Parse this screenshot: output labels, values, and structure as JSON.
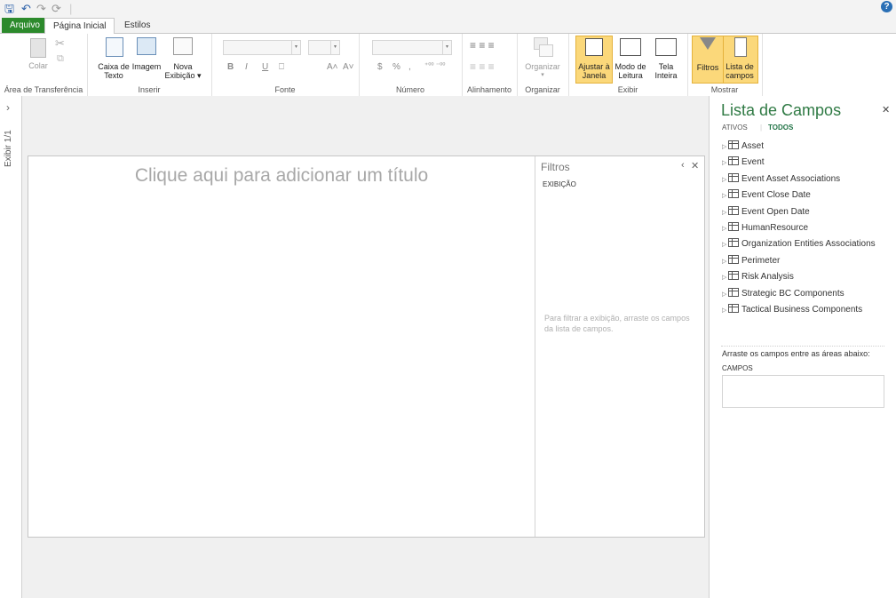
{
  "quick_access": {
    "save_icon": "save-icon",
    "undo_icon": "undo-icon",
    "redo_icon": "redo-icon",
    "refresh_icon": "refresh-icon"
  },
  "tabs": {
    "file": "Arquivo",
    "home": "Página Inicial",
    "styles": "Estilos"
  },
  "ribbon": {
    "clipboard": {
      "paste": "Colar",
      "group": "Área de Transferência"
    },
    "insert": {
      "textbox_1": "Caixa de",
      "textbox_2": "Texto",
      "image": "Imagem",
      "newview_1": "Nova",
      "newview_2": "Exibição ▾",
      "group": "Inserir"
    },
    "font": {
      "bold": "B",
      "italic": "I",
      "underline": "U",
      "grow": "A˄",
      "shrink": "A˅",
      "group": "Fonte"
    },
    "number": {
      "currency": "$",
      "percent": "%",
      "thousands": ",",
      "inc_dec": "⁺⁰⁰ ⁻⁰⁰",
      "group": "Número"
    },
    "alignment": {
      "group": "Alinhamento"
    },
    "arrange": {
      "arrange": "Organizar",
      "group": "Organizar"
    },
    "view": {
      "fit_1": "Ajustar à",
      "fit_2": "Janela",
      "reading_1": "Modo de",
      "reading_2": "Leitura",
      "full_1": "Tela",
      "full_2": "Inteira",
      "group": "Exibir"
    },
    "show": {
      "filters": "Filtros",
      "fieldlist_1": "Lista de",
      "fieldlist_2": "campos",
      "group": "Mostrar"
    }
  },
  "left_strip": {
    "label": "Exibir 1/1",
    "expand_icon": "chevron-right-icon"
  },
  "view": {
    "title_placeholder": "Clique aqui para adicionar um título"
  },
  "filters": {
    "title": "Filtros",
    "section": "EXIBIÇÃO",
    "hint_1": "Para filtrar a exibição, arraste os campos",
    "hint_2": "da lista de campos."
  },
  "field_list": {
    "title": "Lista de Campos",
    "tab_active": "ATIVOS",
    "tab_all": "TODOS",
    "items": [
      "Asset",
      "Event",
      "Event Asset Associations",
      "Event Close Date",
      "Event Open Date",
      "HumanResource",
      "Organization Entities Associations",
      "Perimeter",
      "Risk Analysis",
      "Strategic BC Components",
      "Tactical Business Components"
    ],
    "drag_hint": "Arraste os campos entre as áreas abaixo:",
    "fields_label": "CAMPOS"
  },
  "colors": {
    "file_tab": "#2c8a2c",
    "highlight": "#fbd87a",
    "accent_green": "#217346"
  }
}
